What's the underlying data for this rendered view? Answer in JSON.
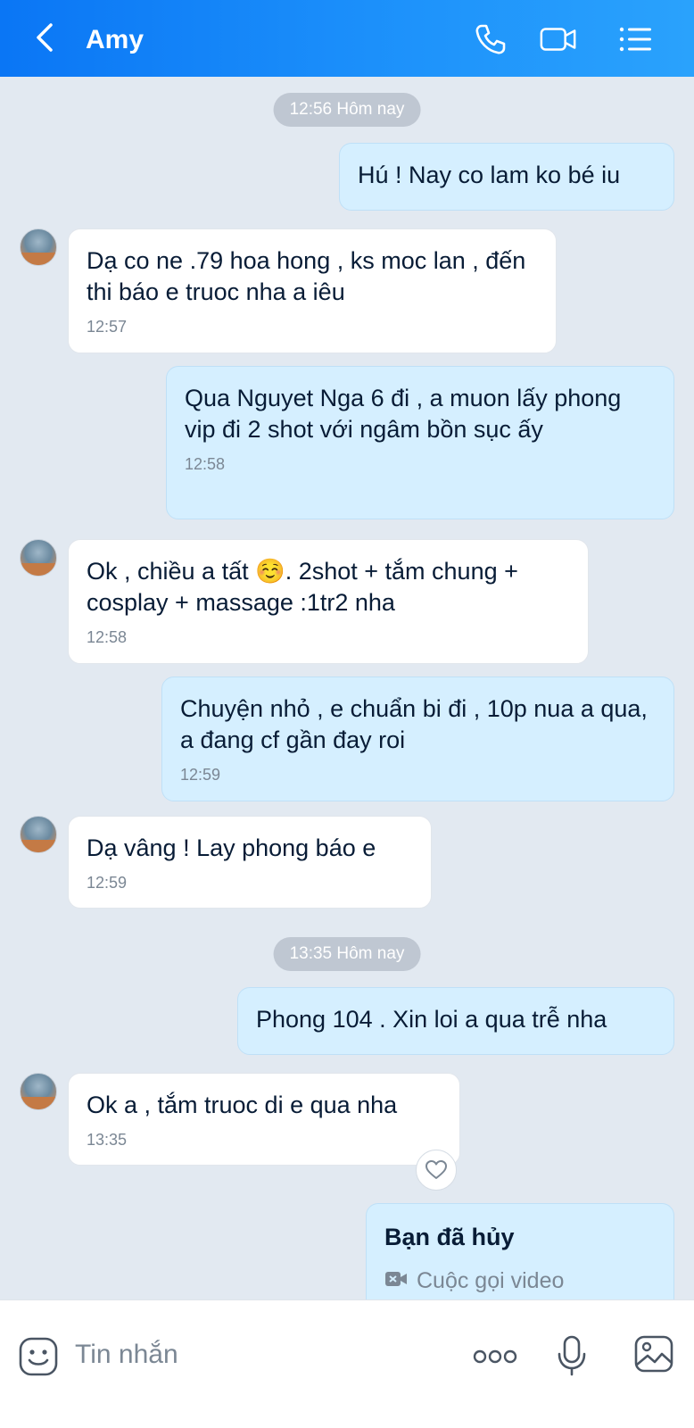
{
  "header": {
    "title": "Amy"
  },
  "icons": {
    "back": "back-arrow-icon",
    "call": "phone-icon",
    "video": "video-camera-icon",
    "menu": "list-menu-icon"
  },
  "dividers": [
    {
      "label": "12:56 Hôm nay"
    },
    {
      "label": "13:35 Hôm nay"
    }
  ],
  "messages": [
    {
      "dir": "out",
      "text": "Hú ! Nay co lam ko bé iu",
      "time": ""
    },
    {
      "dir": "in",
      "text": "Dạ co ne .79 hoa hong , ks moc lan , đến thi báo e truoc nha a iêu",
      "time": "12:57"
    },
    {
      "dir": "out",
      "text": "Qua Nguyet Nga 6 đi , a muon lấy phong vip đi 2 shot với ngâm bồn sục ấy",
      "time": "12:58"
    },
    {
      "dir": "in",
      "text": "Ok , chiều a tất ☺️. 2shot + tắm chung + cosplay + massage :1tr2 nha",
      "time": "12:58"
    },
    {
      "dir": "out",
      "text": "Chuyện nhỏ , e chuẩn bi đi , 10p nua a qua, a đang cf gần đay roi",
      "time": "12:59"
    },
    {
      "dir": "in",
      "text": "Dạ vâng ! Lay phong báo e",
      "time": "12:59"
    },
    {
      "dir": "out",
      "text": "Phong 104 . Xin loi a qua trễ nha",
      "time": ""
    },
    {
      "dir": "in",
      "text": "Ok a , tắm truoc di e qua nha",
      "time": "13:35"
    }
  ],
  "cancelled_call": {
    "title": "Bạn đã hủy",
    "subtitle": "Cuộc gọi video"
  },
  "composer": {
    "placeholder": "Tin nhắn"
  }
}
